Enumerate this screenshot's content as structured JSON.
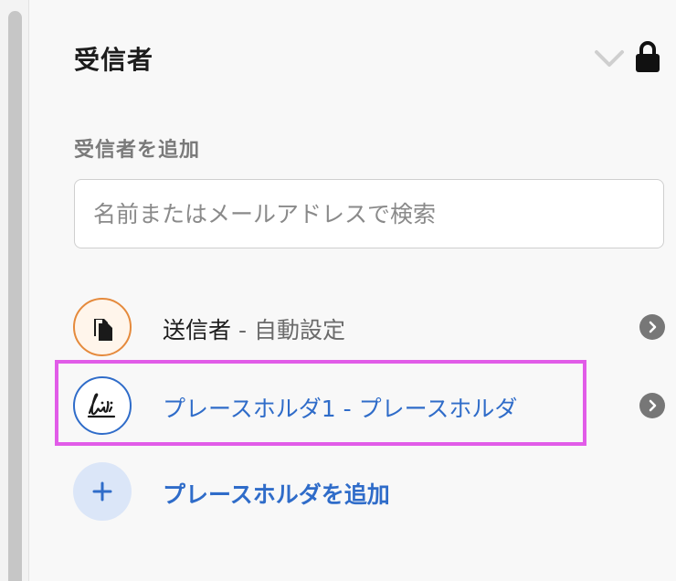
{
  "panel": {
    "title": "受信者",
    "add_recipient_label": "受信者を追加",
    "search": {
      "placeholder": "名前またはメールアドレスで検索",
      "value": ""
    }
  },
  "recipients": [
    {
      "name": "送信者",
      "separator": " - ",
      "role": "自動設定",
      "icon": "stamp-icon",
      "color": "#e58a3c"
    },
    {
      "name": "プレースホルダ1",
      "separator": " - ",
      "role": "プレースホルダ",
      "icon": "signature-icon",
      "color": "#2f6cc9"
    }
  ],
  "add_placeholder": {
    "label": "プレースホルダを追加",
    "icon": "plus-icon"
  },
  "colors": {
    "accent": "#2f6cc9",
    "highlight": "#e15ce8"
  }
}
